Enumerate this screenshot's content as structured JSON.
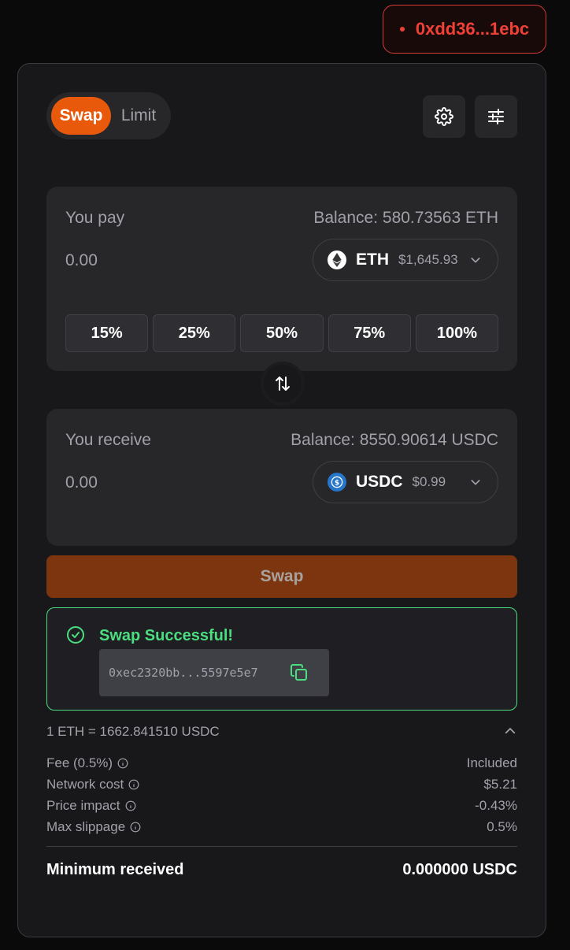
{
  "wallet": {
    "address": "0xdd36...1ebc"
  },
  "mode": {
    "swap_label": "Swap",
    "limit_label": "Limit"
  },
  "pay": {
    "label": "You pay",
    "balance": "Balance: 580.73563 ETH",
    "amount": "0.00",
    "token": {
      "symbol": "ETH",
      "price": "$1,645.93",
      "icon": "ethereum-icon"
    }
  },
  "percent_buttons": [
    "15%",
    "25%",
    "50%",
    "75%",
    "100%"
  ],
  "receive": {
    "label": "You receive",
    "balance": "Balance: 8550.90614 USDC",
    "amount": "0.00",
    "token": {
      "symbol": "USDC",
      "price": "$0.99",
      "icon": "usdc-icon"
    }
  },
  "swap_button": {
    "label": "Swap"
  },
  "success": {
    "message": "Swap Successful!",
    "tx_hash": "0xec2320bb...5597e5e7"
  },
  "rate": "1 ETH = 1662.841510 USDC",
  "details": [
    {
      "label": "Fee (0.5%)",
      "value": "Included"
    },
    {
      "label": "Network cost",
      "value": "$5.21"
    },
    {
      "label": "Price impact",
      "value": "-0.43%"
    },
    {
      "label": "Max slippage",
      "value": "0.5%"
    }
  ],
  "minimum_received": {
    "label": "Minimum received",
    "value": "0.000000 USDC"
  },
  "colors": {
    "accent": "#e8590c",
    "success": "#4ade80",
    "wallet": "#ef4136",
    "swap_disabled": "#7c350f"
  }
}
